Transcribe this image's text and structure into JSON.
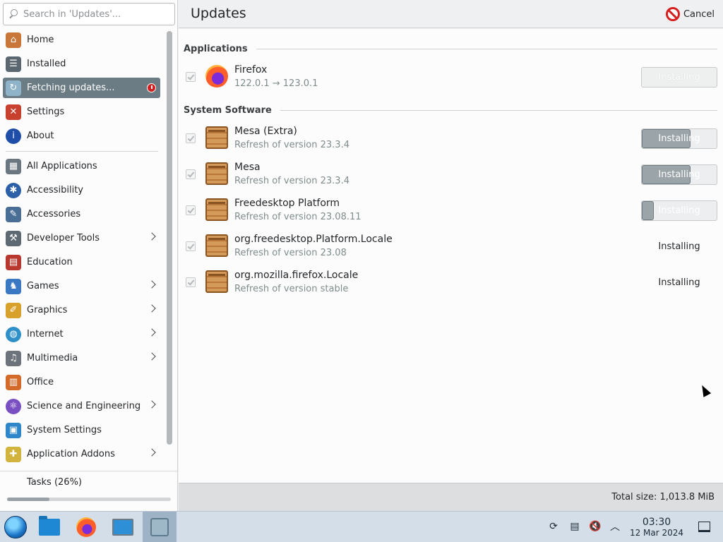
{
  "search": {
    "placeholder": "Search in 'Updates'..."
  },
  "sidebar": {
    "top_items": [
      {
        "label": "Home",
        "icon": "home-icon",
        "color": "#c9763a"
      },
      {
        "label": "Installed",
        "icon": "list-icon",
        "color": "#5b6770"
      },
      {
        "label": "Fetching updates...",
        "icon": "updates-icon",
        "color": "#8fb3c9",
        "active": true
      },
      {
        "label": "Settings",
        "icon": "tools-icon",
        "color": "#c8402e"
      },
      {
        "label": "About",
        "icon": "info-icon",
        "color": "#1f4ea8"
      }
    ],
    "categories": [
      {
        "label": "All Applications",
        "icon": "grid-icon",
        "color": "#6a7780",
        "submenu": false
      },
      {
        "label": "Accessibility",
        "icon": "accessibility-icon",
        "color": "#2b5fa8",
        "submenu": false
      },
      {
        "label": "Accessories",
        "icon": "accessories-icon",
        "color": "#4a6f96",
        "submenu": false
      },
      {
        "label": "Developer Tools",
        "icon": "developer-icon",
        "color": "#5e6a73",
        "submenu": true
      },
      {
        "label": "Education",
        "icon": "education-icon",
        "color": "#b8382f",
        "submenu": false
      },
      {
        "label": "Games",
        "icon": "games-icon",
        "color": "#3a78c4",
        "submenu": true
      },
      {
        "label": "Graphics",
        "icon": "graphics-icon",
        "color": "#d8a12b",
        "submenu": true
      },
      {
        "label": "Internet",
        "icon": "internet-icon",
        "color": "#2f8fc9",
        "submenu": true
      },
      {
        "label": "Multimedia",
        "icon": "multimedia-icon",
        "color": "#6d737a",
        "submenu": true
      },
      {
        "label": "Office",
        "icon": "office-icon",
        "color": "#d46a2a",
        "submenu": false
      },
      {
        "label": "Science and Engineering",
        "icon": "science-icon",
        "color": "#7a4fc2",
        "submenu": true
      },
      {
        "label": "System Settings",
        "icon": "system-settings-icon",
        "color": "#2f86c8",
        "submenu": false
      },
      {
        "label": "Application Addons",
        "icon": "addons-icon",
        "color": "#d1b33d",
        "submenu": true
      }
    ]
  },
  "tasks": {
    "label": "Tasks (26%)",
    "progress": 0.26
  },
  "header": {
    "title": "Updates",
    "cancel_label": "Cancel"
  },
  "sections": {
    "applications": "Applications",
    "system": "System Software"
  },
  "updates": [
    {
      "name": "Firefox",
      "detail": "122.0.1 → 123.0.1",
      "icon": "firefox-icon",
      "status": "Installing",
      "progress": 0,
      "style": "disabled"
    },
    {
      "name": "Mesa (Extra)",
      "detail": "Refresh of version 23.3.4",
      "icon": "package-icon",
      "status": "Installing",
      "progress": 0.65,
      "style": "bar"
    },
    {
      "name": "Mesa",
      "detail": "Refresh of version 23.3.4",
      "icon": "package-icon",
      "status": "Installing",
      "progress": 0.65,
      "style": "bar"
    },
    {
      "name": "Freedesktop Platform",
      "detail": "Refresh of version 23.08.11",
      "icon": "package-icon",
      "status": "Installing",
      "progress": 0.16,
      "style": "bar"
    },
    {
      "name": "org.freedesktop.Platform.Locale",
      "detail": "Refresh of version 23.08",
      "icon": "package-icon",
      "status": "Installing",
      "progress": null,
      "style": "plain"
    },
    {
      "name": "org.mozilla.firefox.Locale",
      "detail": "Refresh of version stable",
      "icon": "package-icon",
      "status": "Installing",
      "progress": null,
      "style": "plain"
    }
  ],
  "footer": {
    "total": "Total size: 1,013.8 MiB"
  },
  "taskbar": {
    "apps": [
      "start-menu-icon",
      "file-manager-icon",
      "firefox-icon",
      "system-settings-icon",
      "discover-icon"
    ],
    "tray": [
      "updates-tray-icon",
      "clipboard-icon",
      "volume-muted-icon",
      "tray-expand-icon"
    ],
    "time": "03:30",
    "date": "12 Mar 2024"
  },
  "colors": {
    "accent": "#6b7c85",
    "cancel_red": "#d71f1f"
  }
}
